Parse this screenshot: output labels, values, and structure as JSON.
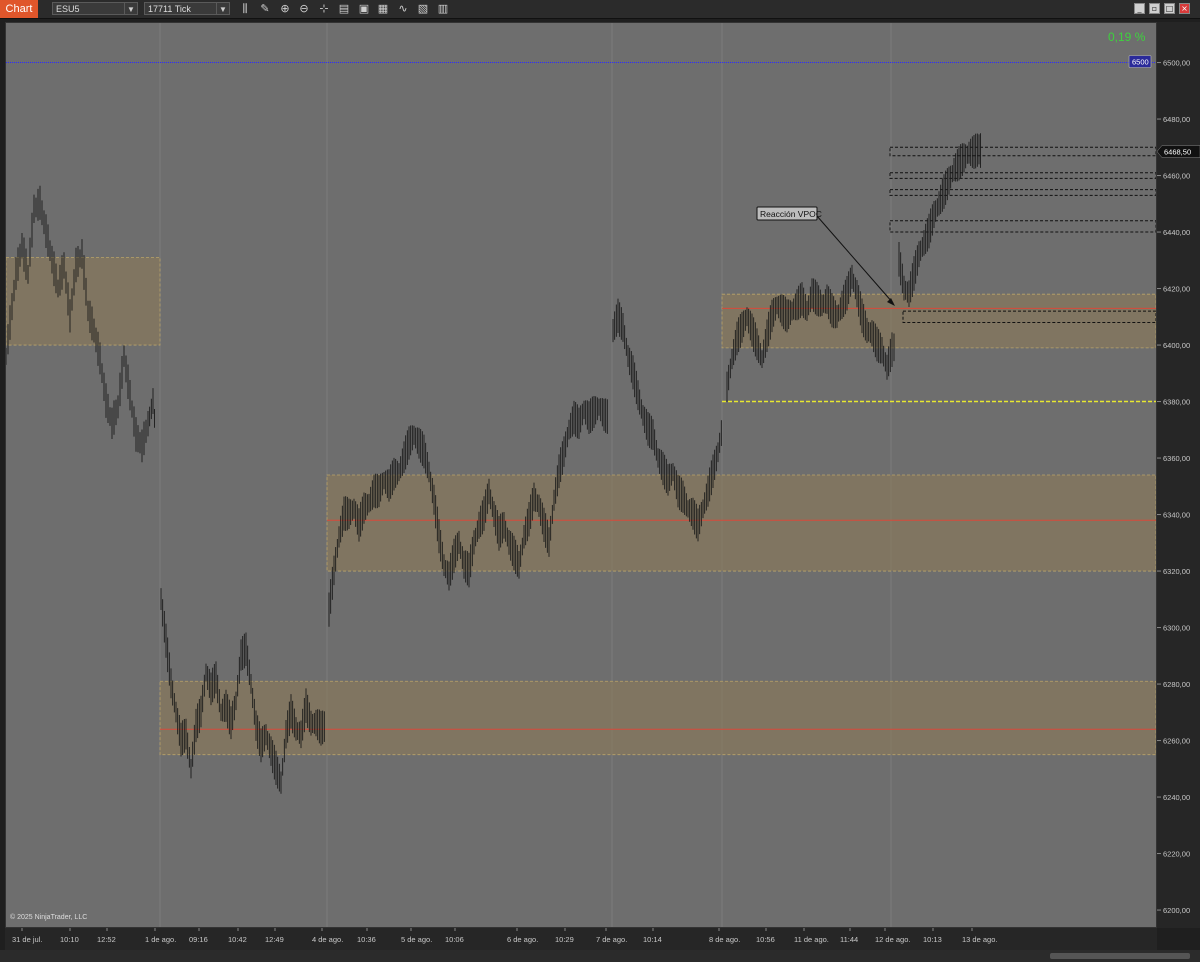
{
  "toolbar": {
    "tab_label": "Chart",
    "instrument": "ESU5",
    "interval": "17711 Tick"
  },
  "chart": {
    "percent_change": "0,19 %",
    "copyright": "© 2025 NinjaTrader, LLC",
    "last_price_label": "6468,50",
    "blue_level_label": "6500",
    "annotation_text": "Reacción VPOC",
    "bar_color": "#1a1a1a",
    "zone_fill": "#8a7a5a",
    "poc_color": "#d84a3a",
    "yellow_line_color": "#e8e830",
    "blue_line_color": "#2b2bff"
  },
  "chart_data": {
    "type": "ohlc",
    "y_range": [
      6194,
      6514
    ],
    "y_ticks": [
      "6500,00",
      "6480,00",
      "6460,00",
      "6440,00",
      "6420,00",
      "6400,00",
      "6380,00",
      "6360,00",
      "6340,00",
      "6320,00",
      "6300,00",
      "6280,00",
      "6260,00",
      "6240,00",
      "6220,00",
      "6200,00"
    ],
    "x_ticks": [
      "31 de jul.",
      "10:10",
      "12:52",
      "1 de ago.",
      "09:16",
      "10:42",
      "12:49",
      "4 de ago.",
      "10:36",
      "5 de ago.",
      "10:06",
      "6 de ago.",
      "10:29",
      "7 de ago.",
      "10:14",
      "8 de ago.",
      "10:56",
      "11 de ago.",
      "11:44",
      "12 de ago.",
      "10:13",
      "13 de ago."
    ],
    "price_path": [
      [
        0,
        6396
      ],
      [
        10,
        6425
      ],
      [
        16,
        6435
      ],
      [
        22,
        6425
      ],
      [
        28,
        6448
      ],
      [
        34,
        6450
      ],
      [
        40,
        6440
      ],
      [
        46,
        6430
      ],
      [
        52,
        6420
      ],
      [
        58,
        6428
      ],
      [
        64,
        6410
      ],
      [
        70,
        6428
      ],
      [
        76,
        6432
      ],
      [
        82,
        6412
      ],
      [
        88,
        6405
      ],
      [
        94,
        6395
      ],
      [
        100,
        6380
      ],
      [
        106,
        6372
      ],
      [
        112,
        6378
      ],
      [
        118,
        6396
      ],
      [
        124,
        6382
      ],
      [
        130,
        6368
      ],
      [
        136,
        6364
      ],
      [
        142,
        6372
      ],
      [
        147,
        6380
      ],
      [
        150,
        6368
      ],
      [
        155,
        6310
      ],
      [
        160,
        6295
      ],
      [
        165,
        6280
      ],
      [
        170,
        6270
      ],
      [
        175,
        6260
      ],
      [
        180,
        6262
      ],
      [
        185,
        6250
      ],
      [
        190,
        6265
      ],
      [
        195,
        6270
      ],
      [
        200,
        6284
      ],
      [
        205,
        6278
      ],
      [
        210,
        6282
      ],
      [
        215,
        6270
      ],
      [
        220,
        6272
      ],
      [
        225,
        6266
      ],
      [
        230,
        6274
      ],
      [
        235,
        6290
      ],
      [
        240,
        6292
      ],
      [
        245,
        6280
      ],
      [
        250,
        6265
      ],
      [
        255,
        6258
      ],
      [
        260,
        6262
      ],
      [
        265,
        6256
      ],
      [
        270,
        6250
      ],
      [
        275,
        6245
      ],
      [
        280,
        6262
      ],
      [
        285,
        6270
      ],
      [
        290,
        6264
      ],
      [
        295,
        6262
      ],
      [
        300,
        6272
      ],
      [
        305,
        6266
      ],
      [
        310,
        6266
      ],
      [
        315,
        6264
      ],
      [
        320,
        6265
      ],
      [
        323,
        6306
      ],
      [
        328,
        6320
      ],
      [
        333,
        6332
      ],
      [
        338,
        6340
      ],
      [
        343,
        6340
      ],
      [
        348,
        6342
      ],
      [
        353,
        6336
      ],
      [
        358,
        6342
      ],
      [
        363,
        6344
      ],
      [
        368,
        6348
      ],
      [
        373,
        6348
      ],
      [
        378,
        6352
      ],
      [
        383,
        6350
      ],
      [
        388,
        6354
      ],
      [
        393,
        6355
      ],
      [
        398,
        6360
      ],
      [
        403,
        6365
      ],
      [
        408,
        6368
      ],
      [
        413,
        6365
      ],
      [
        418,
        6362
      ],
      [
        423,
        6355
      ],
      [
        428,
        6345
      ],
      [
        433,
        6332
      ],
      [
        438,
        6322
      ],
      [
        443,
        6318
      ],
      [
        448,
        6325
      ],
      [
        453,
        6330
      ],
      [
        458,
        6322
      ],
      [
        463,
        6320
      ],
      [
        468,
        6330
      ],
      [
        473,
        6336
      ],
      [
        478,
        6340
      ],
      [
        483,
        6348
      ],
      [
        488,
        6340
      ],
      [
        493,
        6333
      ],
      [
        498,
        6336
      ],
      [
        503,
        6330
      ],
      [
        508,
        6326
      ],
      [
        513,
        6322
      ],
      [
        518,
        6332
      ],
      [
        523,
        6338
      ],
      [
        528,
        6346
      ],
      [
        533,
        6343
      ],
      [
        538,
        6336
      ],
      [
        543,
        6330
      ],
      [
        548,
        6345
      ],
      [
        553,
        6355
      ],
      [
        558,
        6362
      ],
      [
        563,
        6370
      ],
      [
        568,
        6374
      ],
      [
        573,
        6372
      ],
      [
        578,
        6377
      ],
      [
        583,
        6374
      ],
      [
        588,
        6376
      ],
      [
        593,
        6378
      ],
      [
        598,
        6375
      ],
      [
        603,
        6374
      ],
      [
        607,
        6405
      ],
      [
        612,
        6410
      ],
      [
        617,
        6406
      ],
      [
        622,
        6396
      ],
      [
        627,
        6390
      ],
      [
        632,
        6382
      ],
      [
        637,
        6375
      ],
      [
        642,
        6370
      ],
      [
        647,
        6368
      ],
      [
        652,
        6360
      ],
      [
        657,
        6356
      ],
      [
        662,
        6352
      ],
      [
        667,
        6355
      ],
      [
        672,
        6348
      ],
      [
        677,
        6346
      ],
      [
        682,
        6342
      ],
      [
        687,
        6340
      ],
      [
        692,
        6336
      ],
      [
        697,
        6342
      ],
      [
        702,
        6348
      ],
      [
        707,
        6355
      ],
      [
        712,
        6362
      ],
      [
        717,
        6372
      ],
      [
        721,
        6385
      ],
      [
        726,
        6395
      ],
      [
        731,
        6402
      ],
      [
        736,
        6406
      ],
      [
        741,
        6410
      ],
      [
        746,
        6405
      ],
      [
        751,
        6400
      ],
      [
        756,
        6395
      ],
      [
        761,
        6403
      ],
      [
        766,
        6410
      ],
      [
        771,
        6414
      ],
      [
        776,
        6412
      ],
      [
        781,
        6410
      ],
      [
        786,
        6412
      ],
      [
        791,
        6414
      ],
      [
        796,
        6416
      ],
      [
        801,
        6412
      ],
      [
        806,
        6418
      ],
      [
        811,
        6416
      ],
      [
        816,
        6414
      ],
      [
        821,
        6416
      ],
      [
        826,
        6412
      ],
      [
        831,
        6410
      ],
      [
        836,
        6414
      ],
      [
        841,
        6418
      ],
      [
        846,
        6424
      ],
      [
        851,
        6418
      ],
      [
        856,
        6410
      ],
      [
        861,
        6405
      ],
      [
        866,
        6404
      ],
      [
        871,
        6400
      ],
      [
        876,
        6398
      ],
      [
        881,
        6392
      ],
      [
        886,
        6398
      ],
      [
        890,
        6400
      ],
      [
        893,
        6430
      ],
      [
        898,
        6420
      ],
      [
        903,
        6418
      ],
      [
        908,
        6425
      ],
      [
        913,
        6432
      ],
      [
        918,
        6436
      ],
      [
        923,
        6440
      ],
      [
        928,
        6446
      ],
      [
        933,
        6450
      ],
      [
        938,
        6454
      ],
      [
        943,
        6458
      ],
      [
        948,
        6462
      ],
      [
        953,
        6464
      ],
      [
        958,
        6466
      ],
      [
        963,
        6468
      ],
      [
        968,
        6468
      ],
      [
        973,
        6469
      ],
      [
        976,
        6468
      ]
    ]
  }
}
